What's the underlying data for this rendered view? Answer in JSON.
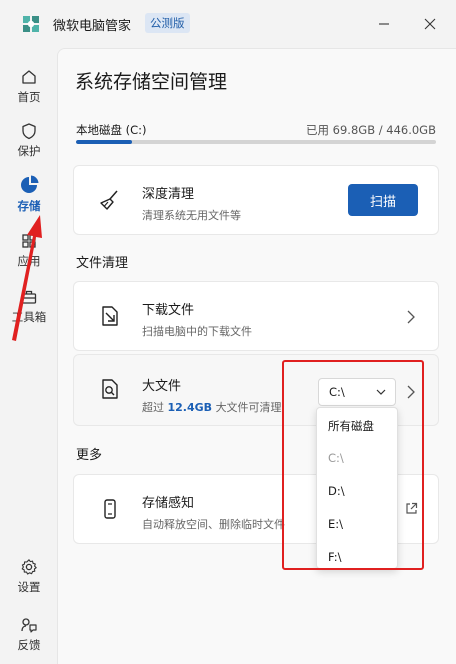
{
  "app": {
    "title": "微软电脑管家",
    "badge": "公测版"
  },
  "window": {
    "minimize_icon": "minimize-icon",
    "close_icon": "close-icon"
  },
  "sidebar": {
    "items": [
      {
        "label": "首页",
        "icon": "home-icon"
      },
      {
        "label": "保护",
        "icon": "shield-icon"
      },
      {
        "label": "存储",
        "icon": "pie-chart-icon",
        "active": true
      },
      {
        "label": "应用",
        "icon": "apps-icon"
      },
      {
        "label": "工具箱",
        "icon": "toolbox-icon"
      }
    ],
    "bottom": [
      {
        "label": "设置",
        "icon": "gear-icon"
      },
      {
        "label": "反馈",
        "icon": "feedback-icon"
      }
    ]
  },
  "page": {
    "title": "系统存储空间管理",
    "disk": {
      "label": "本地磁盘 (C:)",
      "usage": "已用 69.8GB / 446.0GB",
      "used_fraction": 0.156
    }
  },
  "deep_clean": {
    "title": "深度清理",
    "subtitle": "清理系统无用文件等",
    "button": "扫描",
    "icon": "broom-icon"
  },
  "file_cleanup": {
    "section": "文件清理",
    "downloads": {
      "title": "下载文件",
      "subtitle": "扫描电脑中的下载文件",
      "icon": "download-file-icon"
    },
    "large_files": {
      "title": "大文件",
      "subtitle_prefix": "超过",
      "subtitle_value": "12.4GB",
      "subtitle_suffix": "大文件可清理",
      "icon": "search-file-icon",
      "selected_drive": "C:\\"
    }
  },
  "drive_dropdown": {
    "header": "所有磁盘",
    "options": [
      "C:\\",
      "D:\\",
      "E:\\",
      "F:\\"
    ],
    "selected": "C:\\"
  },
  "more": {
    "section": "更多",
    "storage_sense": {
      "title": "存储感知",
      "subtitle": "自动释放空间、删除临时文件",
      "icon": "phone-icon"
    }
  },
  "colors": {
    "accent": "#1b5fb5",
    "annotation": "#e02020"
  }
}
